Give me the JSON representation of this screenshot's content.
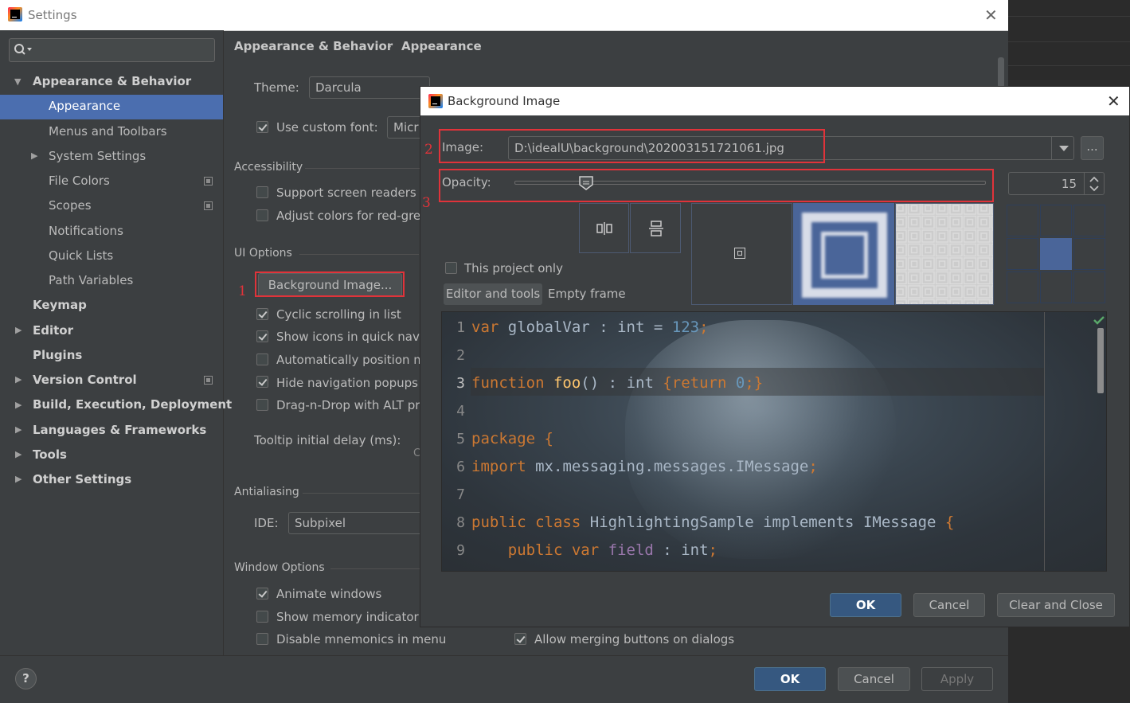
{
  "settings": {
    "title": "Settings",
    "breadcrumb": {
      "parent": "Appearance & Behavior",
      "separator": "›",
      "current": "Appearance"
    },
    "sidebar": {
      "items": [
        {
          "label": "Appearance & Behavior",
          "bold": true,
          "expanded": true
        },
        {
          "label": "Appearance",
          "selected": true
        },
        {
          "label": "Menus and Toolbars"
        },
        {
          "label": "System Settings",
          "expandable": true
        },
        {
          "label": "File Colors",
          "copy_icon": true
        },
        {
          "label": "Scopes",
          "copy_icon": true
        },
        {
          "label": "Notifications"
        },
        {
          "label": "Quick Lists"
        },
        {
          "label": "Path Variables"
        },
        {
          "label": "Keymap",
          "bold": true
        },
        {
          "label": "Editor",
          "bold": true,
          "expandable": true
        },
        {
          "label": "Plugins",
          "bold": true
        },
        {
          "label": "Version Control",
          "bold": true,
          "expandable": true,
          "copy_icon": true
        },
        {
          "label": "Build, Execution, Deployment",
          "bold": true,
          "expandable": true
        },
        {
          "label": "Languages & Frameworks",
          "bold": true,
          "expandable": true
        },
        {
          "label": "Tools",
          "bold": true,
          "expandable": true
        },
        {
          "label": "Other Settings",
          "bold": true,
          "expandable": true
        }
      ]
    },
    "theme": {
      "label": "Theme:",
      "value": "Darcula"
    },
    "custom_font": {
      "label": "Use custom font:",
      "checked": true,
      "value": "Micr"
    },
    "accessibility": {
      "section": "Accessibility",
      "screen_readers": {
        "label": "Support screen readers (",
        "checked": false
      },
      "red_green": {
        "label": "Adjust colors for red-gre",
        "checked": false
      }
    },
    "ui_options": {
      "section": "UI Options",
      "background_image_button": "Background Image...",
      "cyclic": {
        "label": "Cyclic scrolling in list",
        "checked": true
      },
      "show_icons": {
        "label": "Show icons in quick navig",
        "checked": true
      },
      "auto_position": {
        "label": "Automatically position m",
        "checked": false
      },
      "hide_nav": {
        "label": "Hide navigation popups",
        "checked": true
      },
      "drag_drop": {
        "label": "Drag-n-Drop with ALT pr",
        "checked": false
      },
      "tooltip_label": "Tooltip initial delay (ms):",
      "tooltip_fragment": "C"
    },
    "antialiasing": {
      "section": "Antialiasing",
      "ide_label": "IDE:",
      "ide_value": "Subpixel"
    },
    "window_options": {
      "section": "Window Options",
      "animate": {
        "label": "Animate windows",
        "checked": true
      },
      "memory": {
        "label": "Show memory indicator",
        "checked": false
      },
      "mnemonics": {
        "label": "Disable mnemonics in menu",
        "checked": false
      },
      "merging": {
        "label": "Allow merging buttons on dialogs",
        "checked": true
      }
    },
    "buttons": {
      "help": "?",
      "ok": "OK",
      "cancel": "Cancel",
      "apply": "Apply"
    }
  },
  "dialog": {
    "title": "Background Image",
    "image_label": "Image:",
    "image_path": "D:\\idealU\\background\\202003151721061.jpg",
    "browse": "...",
    "opacity_label": "Opacity:",
    "opacity_value": "15",
    "opacity_percent": 15,
    "project_only": {
      "label": "This project only",
      "checked": false
    },
    "tabs": [
      "Editor and tools",
      "Empty frame"
    ],
    "active_tab": 0,
    "annotations": [
      "1",
      "2",
      "3"
    ],
    "code": {
      "line_numbers": [
        "1",
        "2",
        "3",
        "4",
        "5",
        "6",
        "7",
        "8",
        "9"
      ],
      "lines": [
        "var globalVar : int = 123;",
        "",
        "function foo() : int {return 0;}",
        "",
        "package {",
        "import mx.messaging.messages.IMessage;",
        "",
        "public class HighlightingSample implements IMessage {",
        "    public var field : int;"
      ]
    },
    "buttons": {
      "ok": "OK",
      "cancel": "Cancel",
      "clear": "Clear and Close"
    }
  },
  "colors": {
    "accent": "#4b6eaf",
    "primary_button": "#365880",
    "annotation": "#e0333a"
  }
}
